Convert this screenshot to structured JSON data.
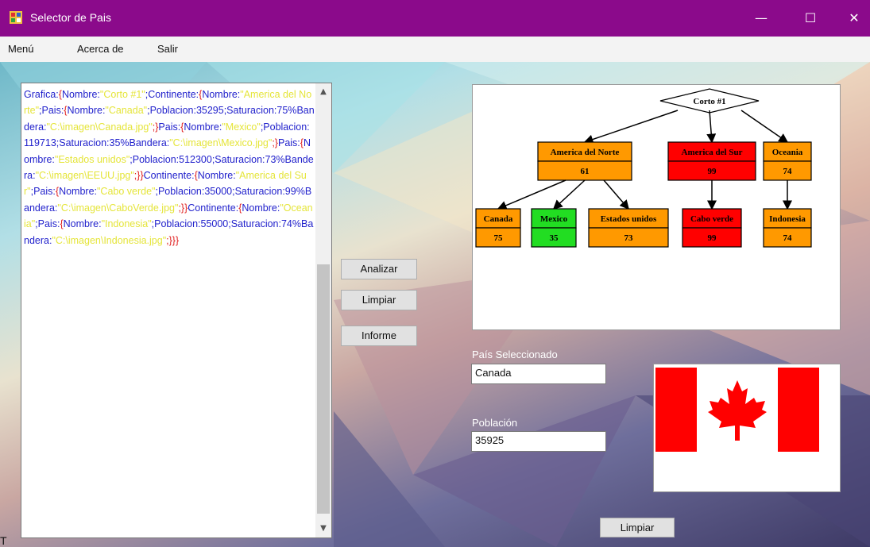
{
  "window": {
    "title": "Selector de Pais",
    "minimize_glyph": "—",
    "maximize_glyph": "☐",
    "close_glyph": "✕"
  },
  "menu": {
    "items": [
      "Menú",
      "Acerca de",
      "Salir"
    ]
  },
  "editor": {
    "segments": [
      {
        "t": "k",
        "v": "Grafica:"
      },
      {
        "t": "b",
        "v": "{"
      },
      {
        "t": "k",
        "v": "Nombre:"
      },
      {
        "t": "s",
        "v": "\"Corto #1\""
      },
      {
        "t": "k",
        "v": ";Continente:"
      },
      {
        "t": "b",
        "v": "{"
      },
      {
        "t": "k",
        "v": "Nombre:"
      },
      {
        "t": "s",
        "v": "\"America del Norte\""
      },
      {
        "t": "k",
        "v": ";Pais:"
      },
      {
        "t": "b",
        "v": "{"
      },
      {
        "t": "k",
        "v": "Nombre:"
      },
      {
        "t": "s",
        "v": "\"Canada\""
      },
      {
        "t": "k",
        "v": ";Poblacion:35295;Saturacion:75%"
      },
      {
        "t": "k",
        "v": "Bandera:"
      },
      {
        "t": "s",
        "v": "\"C:\\imagen\\Canada.jpg\""
      },
      {
        "t": "b",
        "v": ";}"
      },
      {
        "t": "k",
        "v": "Pais:"
      },
      {
        "t": "b",
        "v": "{"
      },
      {
        "t": "k",
        "v": "Nombre:"
      },
      {
        "t": "s",
        "v": "\"Mexico\""
      },
      {
        "t": "k",
        "v": ";Poblacion:119713;Saturacion:35%"
      },
      {
        "t": "k",
        "v": "Bandera:"
      },
      {
        "t": "s",
        "v": "\"C:\\imagen\\Mexico.jpg\""
      },
      {
        "t": "b",
        "v": ";}"
      },
      {
        "t": "k",
        "v": "Pais:"
      },
      {
        "t": "b",
        "v": "{"
      },
      {
        "t": "k",
        "v": "Nombre:"
      },
      {
        "t": "s",
        "v": "\"Estados unidos\""
      },
      {
        "t": "k",
        "v": ";Poblacion:512300;Saturacion:73%Bandera:"
      },
      {
        "t": "s",
        "v": "\"C:\\imagen\\EEUU.jpg\""
      },
      {
        "t": "b",
        "v": ";}}"
      },
      {
        "t": "k",
        "v": "Continente:"
      },
      {
        "t": "b",
        "v": "{"
      },
      {
        "t": "k",
        "v": "Nombre:"
      },
      {
        "t": "s",
        "v": "\"America del Sur\""
      },
      {
        "t": "k",
        "v": ";Pais:"
      },
      {
        "t": "b",
        "v": "{"
      },
      {
        "t": "k",
        "v": "Nombre:"
      },
      {
        "t": "s",
        "v": "\"Cabo verde\""
      },
      {
        "t": "k",
        "v": ";Poblacion:35000;Saturacion:99%Bandera:"
      },
      {
        "t": "s",
        "v": "\"C:\\imagen\\CaboVerde.jpg\""
      },
      {
        "t": "b",
        "v": ";}}"
      },
      {
        "t": "k",
        "v": "Continente:"
      },
      {
        "t": "b",
        "v": "{"
      },
      {
        "t": "k",
        "v": "Nombre:"
      },
      {
        "t": "s",
        "v": "\"Oceania\""
      },
      {
        "t": "k",
        "v": ";Pais:"
      },
      {
        "t": "b",
        "v": "{"
      },
      {
        "t": "k",
        "v": "Nombre:"
      },
      {
        "t": "s",
        "v": "\"Indonesia\""
      },
      {
        "t": "k",
        "v": ";Poblacion:55000;Saturacion:74%"
      },
      {
        "t": "k",
        "v": "Bandera:"
      },
      {
        "t": "s",
        "v": "\"C:\\imagen\\Indonesia.jpg\""
      },
      {
        "t": "b",
        "v": ";}}}"
      }
    ]
  },
  "buttons": {
    "analizar": "Analizar",
    "limpiar": "Limpiar",
    "informe": "Informe",
    "limpiar_bottom": "Limpiar"
  },
  "graph": {
    "root": {
      "label": "Corto #1"
    },
    "continents": [
      {
        "name": "America del Norte",
        "value": "61",
        "color": "#ff9900",
        "countries": [
          {
            "name": "Canada",
            "value": "75",
            "color": "#ff9900"
          },
          {
            "name": "Mexico",
            "value": "35",
            "color": "#22dd22"
          },
          {
            "name": "Estados unidos",
            "value": "73",
            "color": "#ff9900"
          }
        ]
      },
      {
        "name": "America del Sur",
        "value": "99",
        "color": "#ff0000",
        "countries": [
          {
            "name": "Cabo verde",
            "value": "99",
            "color": "#ff0000"
          }
        ]
      },
      {
        "name": "Oceania",
        "value": "74",
        "color": "#ff9900",
        "countries": [
          {
            "name": "Indonesia",
            "value": "74",
            "color": "#ff9900"
          }
        ]
      }
    ]
  },
  "selected": {
    "country_label": "País Seleccionado",
    "country_value": "Canada",
    "population_label": "Población",
    "population_value": "35925"
  },
  "flag": {
    "name": "canada-flag",
    "red": "#ff0000",
    "white": "#ffffff"
  },
  "colors": {
    "titlebar": "#8b0a8b"
  },
  "stray_text": "T"
}
